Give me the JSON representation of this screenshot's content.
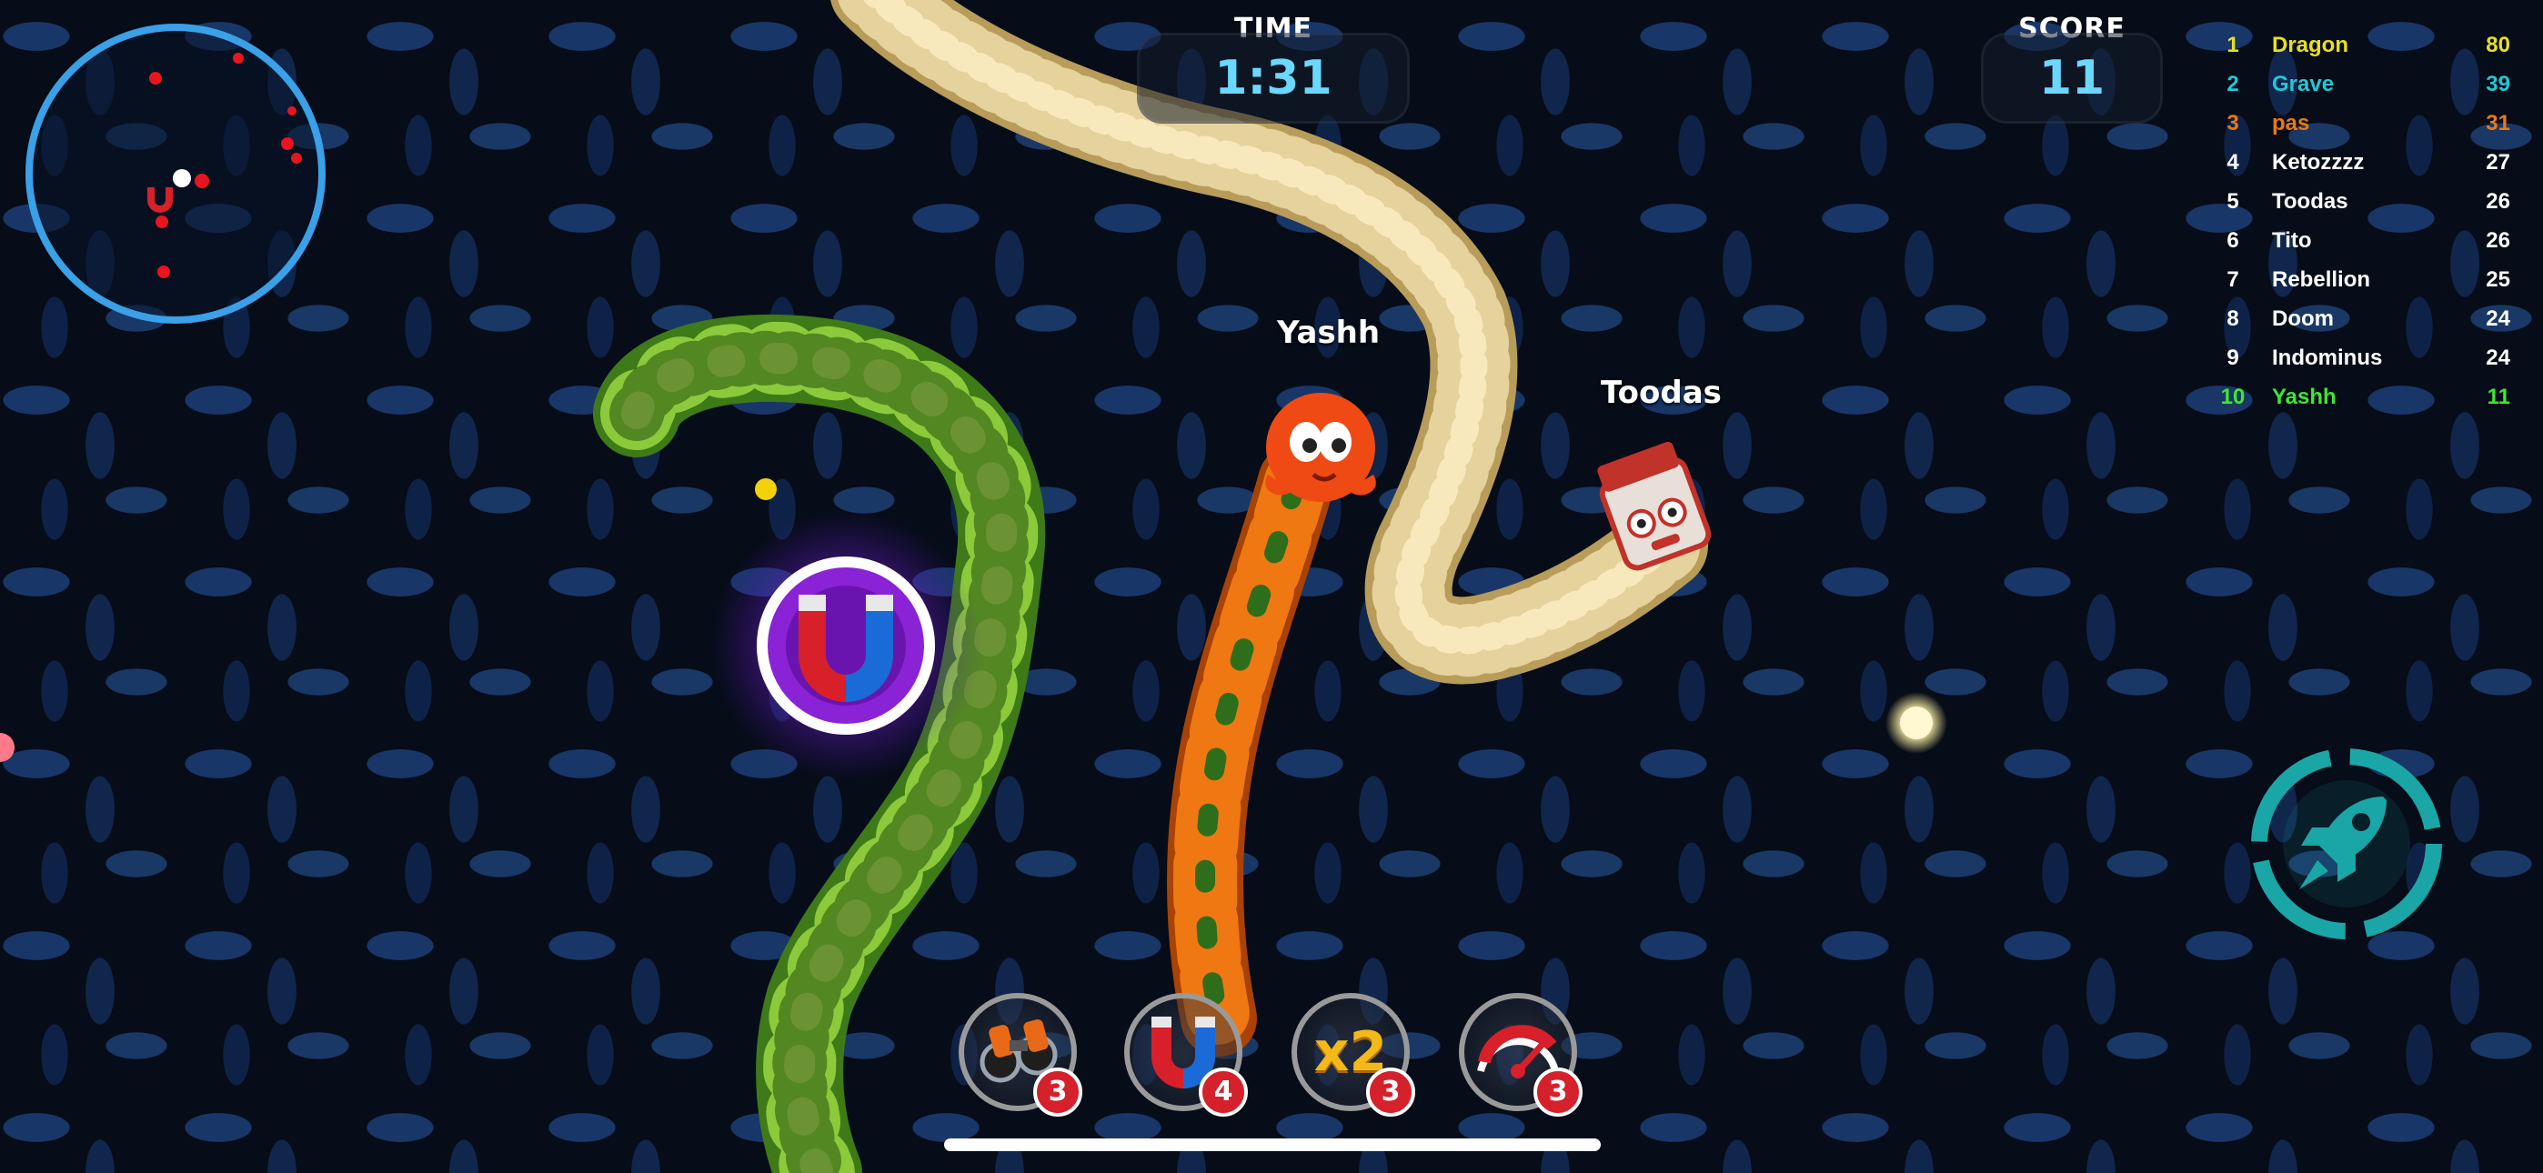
{
  "hud": {
    "time_label": "TIME",
    "time_value": "1:31",
    "score_label": "SCORE",
    "score_value": "11"
  },
  "leaderboard": [
    {
      "rank": "1",
      "name": "Dragon",
      "score": "80",
      "color": "#e8e020"
    },
    {
      "rank": "2",
      "name": "Grave",
      "score": "39",
      "color": "#20c8d8"
    },
    {
      "rank": "3",
      "name": "pas",
      "score": "31",
      "color": "#e87a18"
    },
    {
      "rank": "4",
      "name": "Ketozzzz",
      "score": "27",
      "color": "#ffffff"
    },
    {
      "rank": "5",
      "name": "Toodas",
      "score": "26",
      "color": "#ffffff"
    },
    {
      "rank": "6",
      "name": "Tito",
      "score": "26",
      "color": "#ffffff"
    },
    {
      "rank": "7",
      "name": "Rebellion",
      "score": "25",
      "color": "#ffffff"
    },
    {
      "rank": "8",
      "name": "Doom",
      "score": "24",
      "color": "#ffffff"
    },
    {
      "rank": "9",
      "name": "Indominus",
      "score": "24",
      "color": "#ffffff"
    },
    {
      "rank": "10",
      "name": "Yashh",
      "score": "11",
      "color": "#3ee82e"
    }
  ],
  "players": {
    "self_name": "Yashh",
    "enemy_name": "Toodas"
  },
  "powerups": [
    {
      "icon": "binoculars-icon",
      "count": "3"
    },
    {
      "icon": "magnet-icon",
      "count": "4"
    },
    {
      "icon": "x2-multiplier-icon",
      "count": "3",
      "text": "x2"
    },
    {
      "icon": "speedometer-icon",
      "count": "3"
    }
  ],
  "colors": {
    "hud_accent": "#6ad8ff",
    "minimap_ring": "#3aa0e8",
    "boost_ring": "#1aa6a6",
    "count_badge": "#d4212b"
  }
}
